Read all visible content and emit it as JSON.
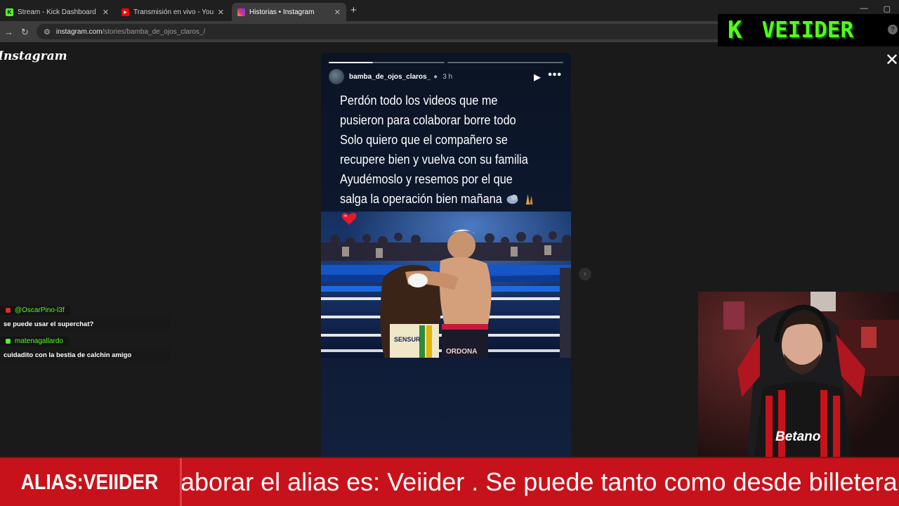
{
  "browser": {
    "tabs": [
      {
        "title": "Stream - Kick Dashboard",
        "icon": "kick-icon",
        "color": "#53fc18"
      },
      {
        "title": "Transmisión en vivo - YouTube",
        "icon": "youtube-icon",
        "color": "#ff0000"
      },
      {
        "title": "Historias • Instagram",
        "icon": "instagram-icon",
        "color": "#d6249f"
      }
    ],
    "url_host": "instagram.com",
    "url_path": "/stories/bamba_de_ojos_claros_/"
  },
  "page": {
    "logo": "Instagram"
  },
  "story": {
    "username": "bamba_de_ojos_claros_",
    "time": "3 h",
    "caption_lines": [
      "Perdón todo los videos que me",
      "pusieron para colaborar borre todo",
      "Solo quiero que el compañero se",
      "recupere bien y vuelva con su familia",
      "Ayudémoslo y resemos por el que",
      "salga la operación bien mañana"
    ],
    "photo_text": [
      "SENSUR",
      "ORDONA"
    ]
  },
  "chat": [
    {
      "user": "@OscarPino-l3f",
      "message": "se puede usar el superchat?",
      "badge_color": "#e02b2b"
    },
    {
      "user": "matenagallardo",
      "message": "cuidadito con la bestia de calchin amigo",
      "badge_color": "#53fc18"
    }
  ],
  "overlay": {
    "logo_k": "K",
    "logo_name": "VEIIDER",
    "alias_label": "ALIAS:VEIIDER",
    "ticker_text": "aborar el alias es: Veiider . Se puede tanto como desde billetera",
    "accent": "#53fc18",
    "ticker_color": "#c8121b"
  },
  "webcam": {
    "shirt_sponsor": "Betano"
  }
}
